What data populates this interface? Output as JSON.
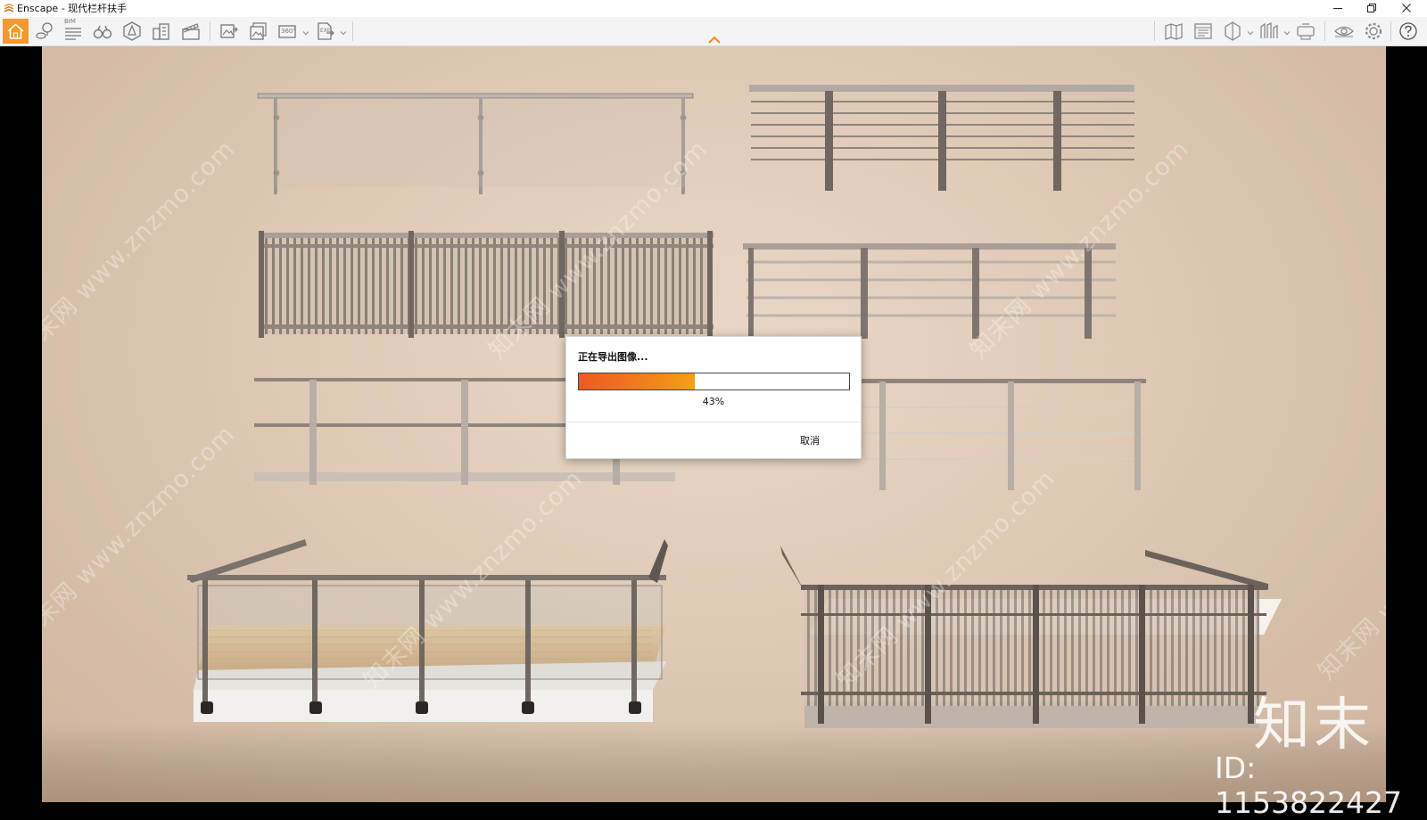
{
  "titlebar": {
    "app_name": "Enscape",
    "separator": " - ",
    "document_name": "现代栏杆扶手",
    "icon": "enscape-logo-icon",
    "controls": [
      "minimize-icon",
      "restore-icon",
      "close-icon"
    ]
  },
  "toolbar": {
    "bim_label": "BIM",
    "panorama_label": "360°",
    "exe_label": "EXE",
    "active_tool": "home",
    "accent_color": "#f39a2b"
  },
  "dialog": {
    "title": "正在导出图像...",
    "percent_text": "43%",
    "progress": 0.43,
    "cancel_label": "取消"
  },
  "overlay": {
    "watermark_text": "知末网 www.znzmo.com",
    "brand_logo": "知末",
    "brand_id": "ID: 1153822427"
  }
}
